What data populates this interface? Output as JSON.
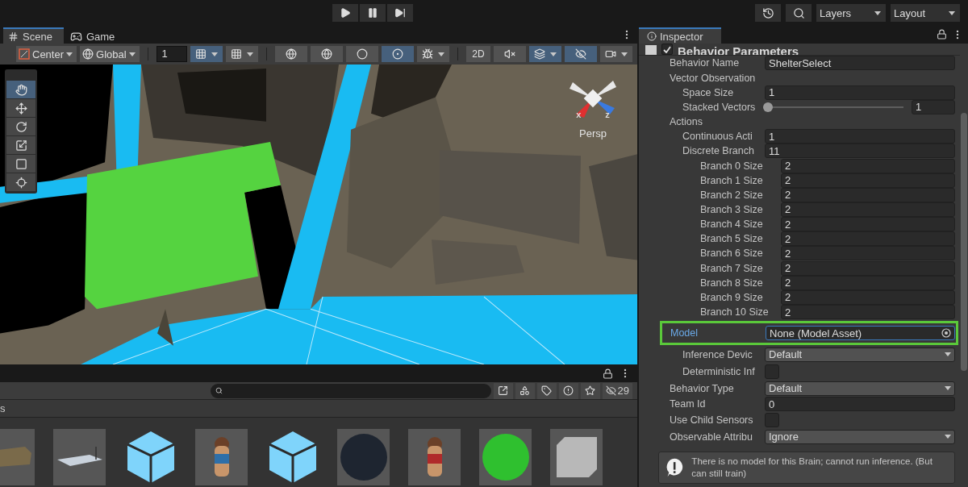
{
  "playbar": {
    "buttons": [
      {
        "kind": "play",
        "selected": false
      },
      {
        "kind": "pause",
        "selected": false
      },
      {
        "kind": "step",
        "selected": false
      }
    ]
  },
  "top_right": {
    "layers": "Layers",
    "layout": "Layout"
  },
  "scene_tabs": [
    {
      "label": "Scene",
      "kind": "scene",
      "selected": true
    },
    {
      "label": "Game",
      "kind": "game",
      "selected": false
    }
  ],
  "scene_toolbar": {
    "pivot": "Center",
    "space": "Global",
    "snap_value": "1",
    "mode_2d": "2D",
    "items": [
      {
        "kind": "grid",
        "selected": true,
        "dropdown": true
      },
      {
        "kind": "snap",
        "selected": false,
        "dropdown": true
      },
      {
        "kind": "wireframe",
        "selected": false,
        "dropdown": false
      },
      {
        "kind": "shaded-wireframe",
        "selected": false,
        "dropdown": false
      },
      {
        "kind": "shaded",
        "selected": false,
        "dropdown": false
      },
      {
        "kind": "lighting",
        "selected": true,
        "dropdown": false
      },
      {
        "kind": "gizmos",
        "selected": false,
        "dropdown": true
      },
      {
        "kind": "flatview",
        "selected": false,
        "dropdown": false
      },
      {
        "kind": "audio",
        "selected": false,
        "dropdown": false
      },
      {
        "kind": "effects",
        "selected": true,
        "dropdown": true
      },
      {
        "kind": "visibility",
        "selected": true,
        "dropdown": false
      },
      {
        "kind": "camera",
        "selected": false,
        "dropdown": true
      }
    ]
  },
  "tools": [
    {
      "kind": "hand",
      "selected": true
    },
    {
      "kind": "move",
      "selected": false
    },
    {
      "kind": "rotate",
      "selected": false
    },
    {
      "kind": "scale",
      "selected": false
    },
    {
      "kind": "rect",
      "selected": false
    },
    {
      "kind": "transform",
      "selected": false
    }
  ],
  "scene_overlay": {
    "view_label": "Persp",
    "gizmo_axes": [
      "x",
      "z"
    ]
  },
  "project": {
    "hidden_count": "29",
    "breadcrumb": "s",
    "filters": [
      {
        "kind": "type"
      },
      {
        "kind": "label"
      },
      {
        "kind": "error"
      },
      {
        "kind": "star"
      }
    ],
    "assets": [
      {
        "kind": "bus"
      },
      {
        "kind": "plane"
      },
      {
        "kind": "prefab"
      },
      {
        "kind": "character",
        "color": "#2f6fa8"
      },
      {
        "kind": "prefab"
      },
      {
        "kind": "sphere",
        "color": "#1e2530"
      },
      {
        "kind": "character",
        "color": "#b02a2a"
      },
      {
        "kind": "sphere",
        "color": "#2fc02f"
      },
      {
        "kind": "cube"
      }
    ]
  },
  "inspector": {
    "tab": "Inspector",
    "component": {
      "title": "Behavior Parameters",
      "enabled": true
    },
    "fields": [
      {
        "kind": "text",
        "label": "Behavior Name",
        "value": "ShelterSelect"
      },
      {
        "kind": "group",
        "label": "Vector Observation",
        "children": [
          {
            "kind": "number",
            "label": "Space Size",
            "value": "1"
          },
          {
            "kind": "slider",
            "label": "Stacked Vectors",
            "level": 0,
            "value": "1"
          }
        ]
      },
      {
        "kind": "group",
        "label": "Actions",
        "children": [
          {
            "kind": "number",
            "label": "Continuous Acti",
            "value": "1"
          },
          {
            "kind": "number",
            "label": "Discrete Branch",
            "value": "11",
            "children": [
              {
                "kind": "number",
                "label": "Branch 0 Size",
                "value": "2"
              },
              {
                "kind": "number",
                "label": "Branch 1 Size",
                "value": "2"
              },
              {
                "kind": "number",
                "label": "Branch 2 Size",
                "value": "2"
              },
              {
                "kind": "number",
                "label": "Branch 3 Size",
                "value": "2"
              },
              {
                "kind": "number",
                "label": "Branch 4 Size",
                "value": "2"
              },
              {
                "kind": "number",
                "label": "Branch 5 Size",
                "value": "2"
              },
              {
                "kind": "number",
                "label": "Branch 6 Size",
                "value": "2"
              },
              {
                "kind": "number",
                "label": "Branch 7 Size",
                "value": "2"
              },
              {
                "kind": "number",
                "label": "Branch 8 Size",
                "value": "2"
              },
              {
                "kind": "number",
                "label": "Branch 9 Size",
                "value": "2"
              },
              {
                "kind": "number",
                "label": "Branch 10 Size",
                "value": "2"
              }
            ]
          }
        ]
      },
      {
        "kind": "object",
        "label": "Model",
        "value": "None (Model Asset)",
        "highlighted": true,
        "children": [
          {
            "kind": "dropdown",
            "label": "Inference Devic",
            "value": "Default"
          },
          {
            "kind": "checkbox",
            "label": "Deterministic Inf",
            "checked": false
          }
        ]
      },
      {
        "kind": "dropdown",
        "label": "Behavior Type",
        "value": "Default"
      },
      {
        "kind": "number",
        "label": "Team Id",
        "value": "0"
      },
      {
        "kind": "checkbox",
        "label": "Use Child Sensors",
        "checked": false
      },
      {
        "kind": "dropdown",
        "label": "Observable Attribu",
        "value": "Ignore"
      }
    ],
    "help": "There is no model for this Brain; cannot run inference. (But can still train)"
  }
}
